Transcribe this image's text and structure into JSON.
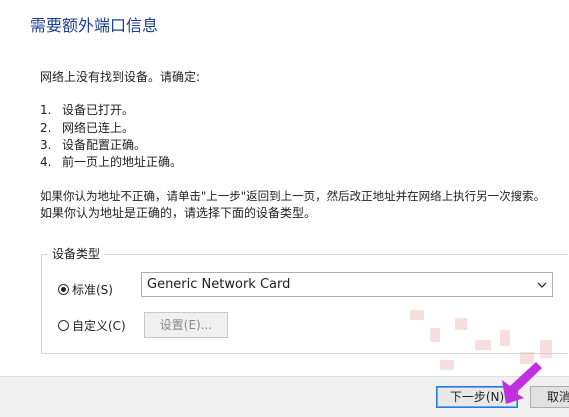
{
  "window": {
    "title": "需要额外端口信息"
  },
  "message": {
    "intro": "网络上没有找到设备。请确定:",
    "items": [
      {
        "num": "1.",
        "text": "设备已打开。"
      },
      {
        "num": "2.",
        "text": "网络已连上。"
      },
      {
        "num": "3.",
        "text": "设备配置正确。"
      },
      {
        "num": "4.",
        "text": "前一页上的地址正确。"
      }
    ],
    "hint1": "如果你认为地址不正确，请单击\"上一步\"返回到上一页，然后改正地址并在网络上执行另一次搜索。",
    "hint2": "如果你认为地址是正确的，请选择下面的设备类型。"
  },
  "device_type": {
    "group_label": "设备类型",
    "standard_label": "标准(S)",
    "standard_selected": true,
    "standard_value": "Generic Network Card",
    "custom_label": "自定义(C)",
    "custom_selected": false,
    "settings_button": "设置(E)..."
  },
  "footer": {
    "next_button": "下一步(N)",
    "cancel_button": "取消"
  },
  "colors": {
    "title": "#1c3f94",
    "focus_border": "#2b78d6",
    "footer_bg": "#f0f0f0",
    "arrow": "#c030e0"
  },
  "icons": {
    "dropdown": "chevron-down-icon",
    "pointer": "pointer-arrow-icon"
  }
}
